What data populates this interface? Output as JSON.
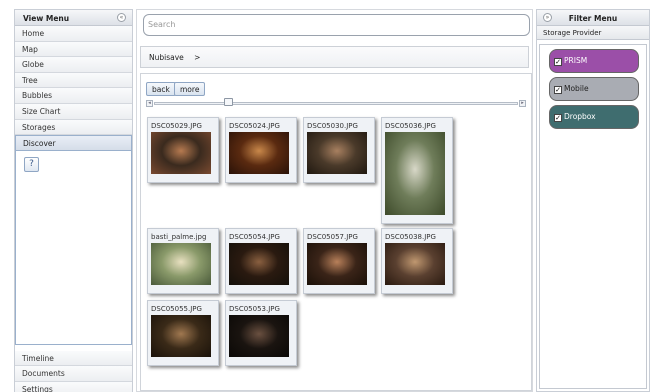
{
  "left_panel": {
    "title": "View Menu",
    "collapse_icon": "<<",
    "items_top": [
      "Home",
      "Map",
      "Globe",
      "Tree",
      "Bubbles",
      "Size Chart",
      "Storages",
      "Discover"
    ],
    "help_label": "?",
    "items_bottom": [
      "Timeline",
      "Documents",
      "Settings"
    ]
  },
  "search": {
    "placeholder": "Search"
  },
  "breadcrumb": {
    "root": "Nubisave",
    "separator": ">"
  },
  "toolbar": {
    "back_label": "back",
    "more_label": "more"
  },
  "thumbnails": [
    {
      "name": "DSC05029.JPG",
      "colors": [
        "#3a2a1e",
        "#b67a50",
        "#7a4a30"
      ]
    },
    {
      "name": "DSC05024.JPG",
      "colors": [
        "#5a2a10",
        "#c9884a",
        "#2a1208"
      ]
    },
    {
      "name": "DSC05030.JPG",
      "colors": [
        "#4a3a2a",
        "#a88060",
        "#201810"
      ]
    },
    {
      "name": "DSC05036.JPG",
      "colors": [
        "#6f7d5a",
        "#d8d8c8",
        "#3d4a2a"
      ]
    },
    {
      "name": "basti_palme.jpg",
      "colors": [
        "#8a9a6a",
        "#e8e0c0",
        "#4a5a3a"
      ]
    },
    {
      "name": "DSC05054.JPG",
      "colors": [
        "#2a1a10",
        "#8a6040",
        "#14100a"
      ]
    },
    {
      "name": "DSC05057.JPG",
      "colors": [
        "#3a2418",
        "#b8805a",
        "#1a1008"
      ]
    },
    {
      "name": "DSC05038.JPG",
      "colors": [
        "#5a4030",
        "#c09870",
        "#2a1a10"
      ]
    },
    {
      "name": "DSC05055.JPG",
      "colors": [
        "#3a2a18",
        "#a07850",
        "#1a120a"
      ]
    },
    {
      "name": "DSC05053.JPG",
      "colors": [
        "#1a1410",
        "#6a5040",
        "#0a0806"
      ]
    }
  ],
  "right_panel": {
    "title": "Filter Menu",
    "collapse_icon": ">>",
    "section_title": "Storage Provider",
    "providers": [
      {
        "label": "PRISM",
        "checked": true,
        "color": "#9b4fa8"
      },
      {
        "label": "Mobile",
        "checked": true,
        "color": "#a9acb3"
      },
      {
        "label": "Dropbox",
        "checked": true,
        "color": "#3f6d6f"
      }
    ],
    "check_mark": "✓"
  }
}
